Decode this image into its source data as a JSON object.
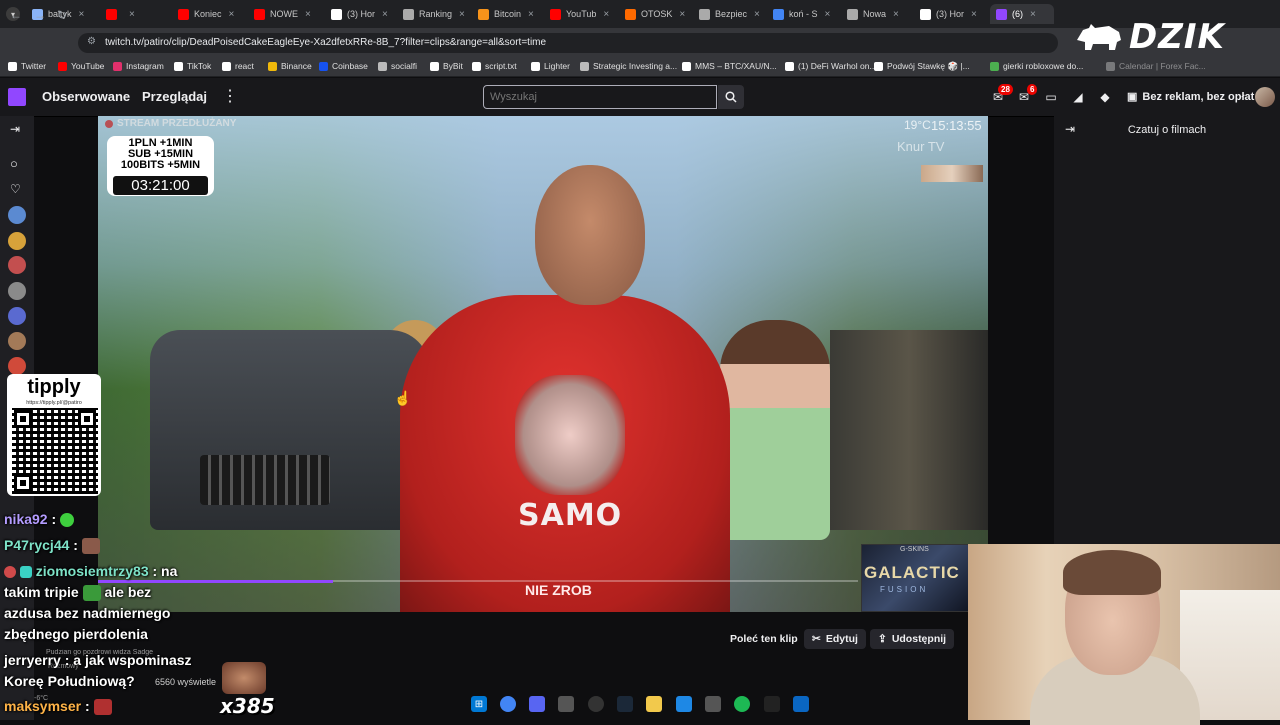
{
  "browser": {
    "tabs": [
      {
        "label": "baltyk",
        "color": "#8ab4f8"
      },
      {
        "label": "",
        "color": "#ff0000"
      },
      {
        "label": "Koniec",
        "color": "#ff0000"
      },
      {
        "label": "NOWE",
        "color": "#ff0000"
      },
      {
        "label": "(3) Hor",
        "color": "#ffffff"
      },
      {
        "label": "Ranking",
        "color": "#aaaaaa"
      },
      {
        "label": "Bitcoin",
        "color": "#f7931a"
      },
      {
        "label": "YouTub",
        "color": "#ff0000"
      },
      {
        "label": "OTOSK",
        "color": "#ff6a00"
      },
      {
        "label": "Bezpiec",
        "color": "#aaaaaa"
      },
      {
        "label": "koń - S",
        "color": "#4285f4"
      },
      {
        "label": "Nowa",
        "color": "#aaaaaa"
      },
      {
        "label": "(3) Hor",
        "color": "#ffffff"
      },
      {
        "label": "(6)",
        "color": "#9147ff"
      }
    ],
    "url": "twitch.tv/patiro/clip/DeadPoisedCakeEagleEye-Xa2dfetxRRe-8B_7?filter=clips&range=all&sort=time",
    "bookmarks": [
      {
        "label": "Twitter",
        "color": "#ffffff"
      },
      {
        "label": "YouTube",
        "color": "#ff0000"
      },
      {
        "label": "Instagram",
        "color": "#e1306c"
      },
      {
        "label": "TikTok",
        "color": "#ffffff"
      },
      {
        "label": "react",
        "color": "#ffffff"
      },
      {
        "label": "Binance",
        "color": "#f0b90b"
      },
      {
        "label": "Coinbase",
        "color": "#1652f0"
      },
      {
        "label": "socialfi",
        "color": "#bbbbbb"
      },
      {
        "label": "ByBit",
        "color": "#ffffff"
      },
      {
        "label": "script.txt",
        "color": "#ffffff"
      },
      {
        "label": "Lighter",
        "color": "#ffffff"
      },
      {
        "label": "Strategic Investing a...",
        "color": "#bbbbbb"
      },
      {
        "label": "MMS – BTC/XAU/N...",
        "color": "#ffffff"
      },
      {
        "label": "(1) DeFi Warhol on...",
        "color": "#ffffff"
      },
      {
        "label": "Podwój Stawkę 🎲 |...",
        "color": "#ffffff"
      },
      {
        "label": "gierki robloxowe do...",
        "color": "#4caf50"
      },
      {
        "label": "Calendar | Forex Fac...",
        "color": "#bbbbbb"
      }
    ]
  },
  "overlay_logo": "DZIK",
  "twitch": {
    "nav": {
      "following": "Obserwowane",
      "browse": "Przeglądaj",
      "search_placeholder": "Wyszukaj",
      "notif_count": "28",
      "inbox_count": "6",
      "adfree": "Bez reklam, bez opłat"
    },
    "right_panel": {
      "title": "Czatuj o filmach"
    },
    "clip_actions": {
      "recommend": "Poleć ten klip",
      "edit": "Edytuj",
      "share": "Udostępnij"
    },
    "view_info": "6560 wyświetle"
  },
  "video": {
    "stream_extended": "STREAM PRZEDŁUŻANY",
    "donation_lines": [
      "1PLN +1MIN",
      "SUB +15MIN",
      "100BITS +5MIN"
    ],
    "timer": "03:21:00",
    "temperature": "19°C",
    "clock": "15:13:55",
    "watermark": "Knur TV",
    "shirt_text": "SAMO",
    "shirt_text2": "NIE ZROB"
  },
  "overlay_chat": {
    "tipply_logo": "tipply",
    "tipply_url": "https://tipply.pl/@patiro",
    "lines": [
      {
        "user": "nika92",
        "text": ":",
        "user_color": "#b49cff"
      },
      {
        "user": "P47rycj44",
        "text": ":",
        "user_color": "#7ee3c8"
      },
      {
        "user": "ziomosiemtrzy83",
        "text": ": na",
        "user_color": "#7ee3c8"
      },
      {
        "user": "",
        "text": "takim tripie",
        "user_color": "#ffffff"
      },
      {
        "user": "",
        "text": "ale bez",
        "user_color": "#ffffff"
      },
      {
        "user": "",
        "text": "azdusa bez nadmiernego",
        "user_color": "#ffffff"
      },
      {
        "user": "",
        "text": "zbędnego pierdolenia",
        "user_color": "#ffffff"
      },
      {
        "user": "jerryerry",
        "text": ": a jak wspominasz",
        "user_color": "#ffffff"
      },
      {
        "user": "",
        "text": "Koreę Południową?",
        "user_color": "#ffffff"
      },
      {
        "user": "maksymser",
        "text": ":",
        "user_color": "#ffb347"
      }
    ],
    "small_lines": [
      "Pudzian go pozdrowi widza Sadge",
      "Rozmowy",
      "-6°C"
    ],
    "gift_count": "x385"
  },
  "sponsor": {
    "top": "G-SKINS",
    "title": "GALACTIC",
    "subtitle": "FUSION"
  }
}
